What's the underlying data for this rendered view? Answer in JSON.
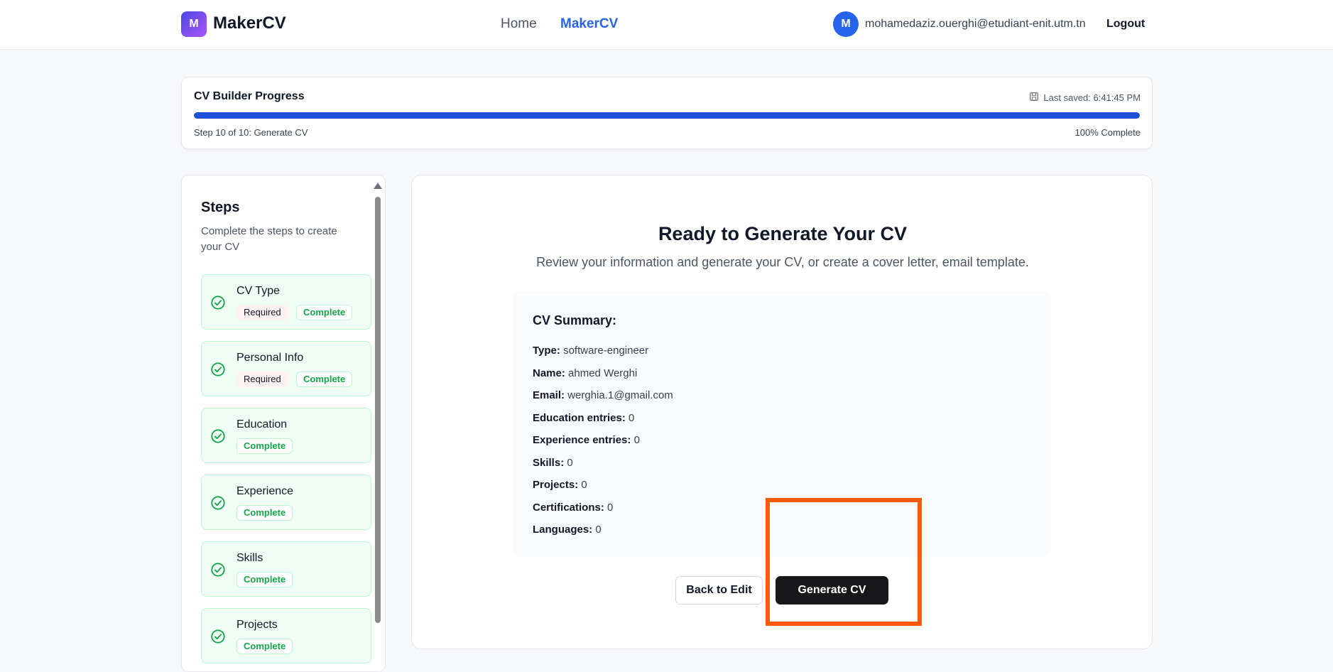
{
  "nav": {
    "logo_letter": "M",
    "brand": "MakerCV",
    "links": [
      {
        "label": "Home"
      },
      {
        "label": "MakerCV"
      }
    ],
    "avatar_letter": "M",
    "user_email": "mohamedaziz.ouerghi@etudiant-enit.utm.tn",
    "logout": "Logout"
  },
  "progress": {
    "title": "CV Builder Progress",
    "last_saved": "Last saved: 6:41:45 PM",
    "step_text": "Step 10 of 10: Generate CV",
    "percent_text": "100% Complete",
    "fraction": 1.0,
    "bar_color": "#1d4ed8"
  },
  "steps": {
    "heading": "Steps",
    "subtitle": "Complete the steps to create your CV",
    "items": [
      {
        "name": "CV Type",
        "required": "Required",
        "status": "Complete"
      },
      {
        "name": "Personal Info",
        "required": "Required",
        "status": "Complete"
      },
      {
        "name": "Education",
        "status": "Complete"
      },
      {
        "name": "Experience",
        "status": "Complete"
      },
      {
        "name": "Skills",
        "status": "Complete"
      },
      {
        "name": "Projects",
        "status": "Complete"
      }
    ]
  },
  "main": {
    "title": "Ready to Generate Your CV",
    "subtitle": "Review your information and generate your CV, or create a cover letter, email template.",
    "summary": {
      "heading": "CV Summary:",
      "rows": [
        {
          "label": "Type:",
          "value": "software-engineer"
        },
        {
          "label": "Name:",
          "value": "ahmed Werghi"
        },
        {
          "label": "Email:",
          "value": "werghia.1@gmail.com"
        },
        {
          "label": "Education entries:",
          "value": "0"
        },
        {
          "label": "Experience entries:",
          "value": "0"
        },
        {
          "label": "Skills:",
          "value": "0"
        },
        {
          "label": "Projects:",
          "value": "0"
        },
        {
          "label": "Certifications:",
          "value": "0"
        },
        {
          "label": "Languages:",
          "value": "0"
        }
      ]
    },
    "back_button": "Back to Edit",
    "generate_button": "Generate CV"
  },
  "colors": {
    "accent": "#2563eb",
    "complete_green": "#16a34a",
    "highlight": "#ff5a0a"
  }
}
